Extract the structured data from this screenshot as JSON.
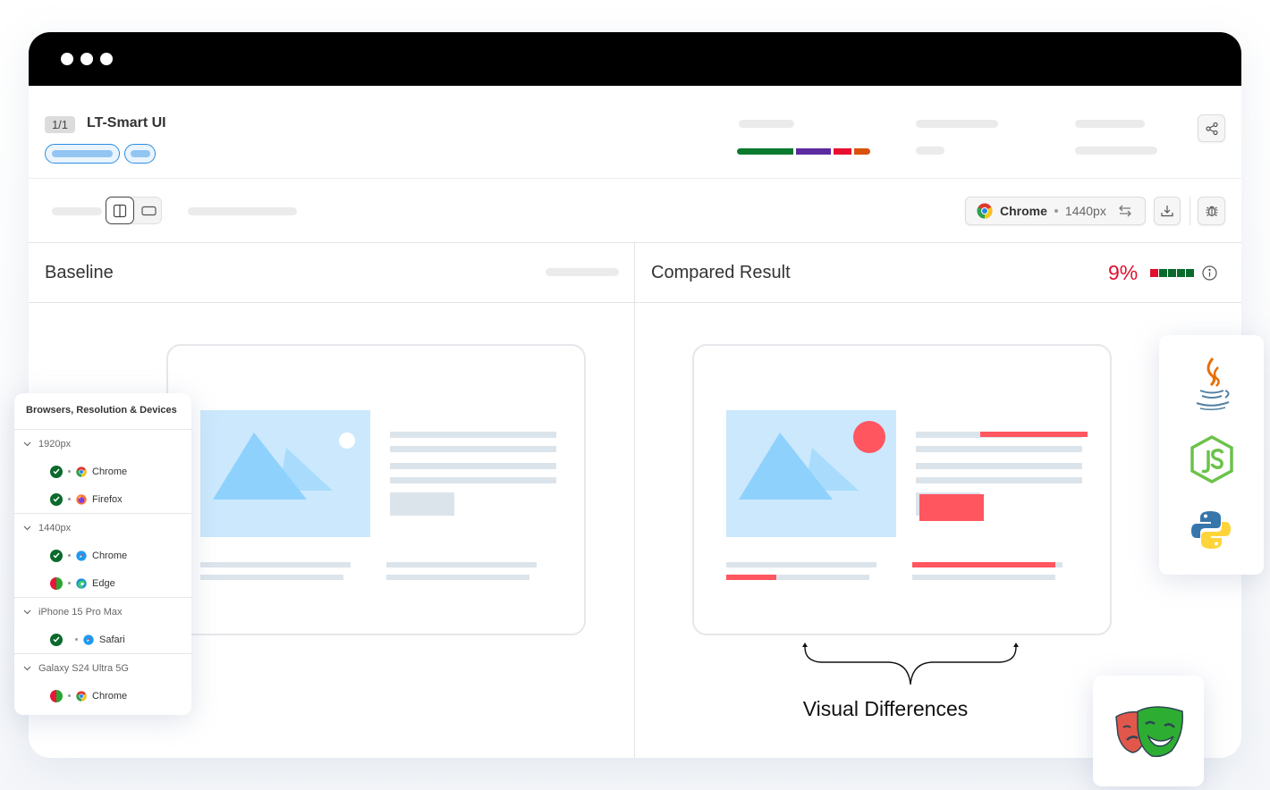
{
  "window": {
    "controls": [
      "dot",
      "dot",
      "dot"
    ]
  },
  "header": {
    "count_badge": "1/1",
    "project_title": "LT-Smart UI",
    "status_segments": [
      {
        "name": "passed",
        "color": "#0a7a2f",
        "fraction": 0.43
      },
      {
        "name": "changes",
        "color": "#5b2ca0",
        "fraction": 0.27
      },
      {
        "name": "failed",
        "color": "#e8102e",
        "fraction": 0.14
      },
      {
        "name": "other",
        "color": "#d9520b",
        "fraction": 0.12
      }
    ],
    "share_icon": "share-icon"
  },
  "toolbar": {
    "view_modes": [
      "side-by-side",
      "single"
    ],
    "active_view_mode": "side-by-side",
    "browser": {
      "name": "Chrome",
      "resolution": "1440px",
      "icon": "chrome-icon"
    },
    "swap_icon": "swap-arrows-icon",
    "download_icon": "download-icon",
    "bug_icon": "bug-icon"
  },
  "baseline": {
    "title": "Baseline"
  },
  "compared": {
    "title": "Compared Result",
    "mismatch_percent": "9%",
    "mismatch_scale": [
      "#e0102e",
      "#0a6a2c",
      "#0a6a2c",
      "#0a6a2c",
      "#0a6a2c"
    ],
    "info_icon": "info-icon"
  },
  "annotation": {
    "label": "Visual Differences"
  },
  "devices": {
    "title": "Browsers, Resolution & Devices",
    "groups": [
      {
        "label": "1920px",
        "items": [
          {
            "browser": "Chrome",
            "icon": "chrome-icon",
            "status": "passed"
          },
          {
            "browser": "Firefox",
            "icon": "firefox-icon",
            "status": "passed"
          }
        ]
      },
      {
        "label": "1440px",
        "items": [
          {
            "browser": "Chrome",
            "icon": "safari-icon",
            "status": "passed"
          },
          {
            "browser": "Edge",
            "icon": "edge-icon",
            "status": "mixed"
          }
        ]
      },
      {
        "label": "iPhone 15 Pro Max",
        "items": [
          {
            "browser": "Safari",
            "icon": "safari-icon",
            "status": "passed"
          }
        ]
      },
      {
        "label": "Galaxy S24 Ultra 5G",
        "items": [
          {
            "browser": "Chrome",
            "icon": "chrome-icon",
            "status": "mixed"
          }
        ]
      }
    ]
  },
  "languages": [
    "java-icon",
    "nodejs-icon",
    "python-icon"
  ],
  "framework": "playwright-icon",
  "colors": {
    "accent_blue": "#2b8de0",
    "diff_red": "#ff5660",
    "placeholder_blue": "#cbe8fd",
    "mountain_blue": "#8fd1fd"
  }
}
